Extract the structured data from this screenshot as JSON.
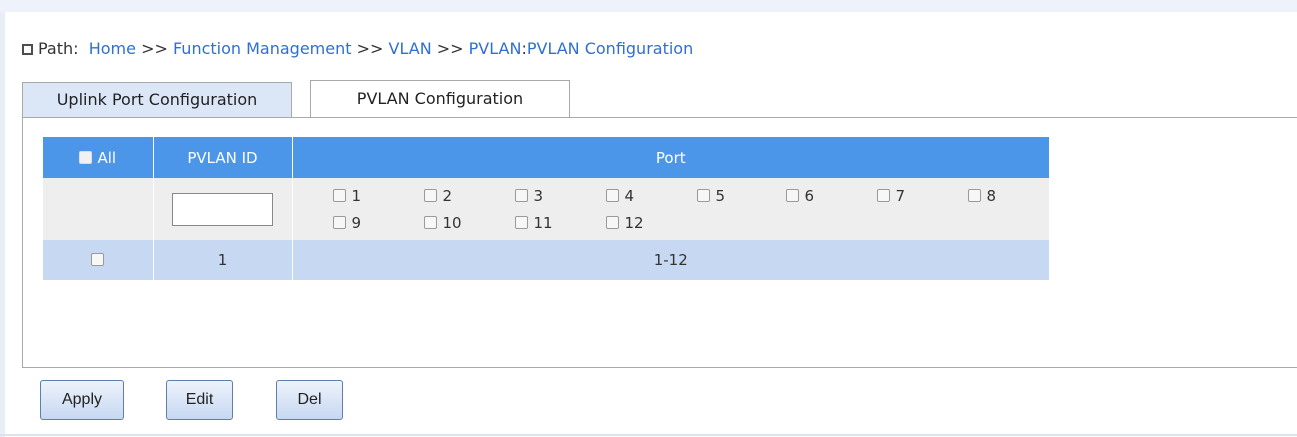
{
  "breadcrumb": {
    "label": "Path:",
    "home": "Home",
    "sep": ">>",
    "function_management": "Function Management",
    "vlan": "VLAN",
    "pvlan": "PVLAN",
    "colon": ":",
    "current": "PVLAN Configuration"
  },
  "tabs": [
    {
      "label": "Uplink Port Configuration",
      "active": false
    },
    {
      "label": "PVLAN Configuration",
      "active": true
    }
  ],
  "table": {
    "headers": {
      "all": "All",
      "pvlan_id": "PVLAN ID",
      "port": "Port"
    },
    "input": {
      "pvlan_id_value": ""
    },
    "ports": [
      "1",
      "2",
      "3",
      "4",
      "5",
      "6",
      "7",
      "8",
      "9",
      "10",
      "11",
      "12"
    ],
    "rows": [
      {
        "checked": false,
        "pvlan_id": "1",
        "port": "1-12"
      }
    ]
  },
  "buttons": {
    "apply": "Apply",
    "edit": "Edit",
    "del": "Del"
  },
  "colors": {
    "header_blue": "#4c96ea",
    "row_blue": "#c7d9f2",
    "link_blue": "#2f6fd1"
  }
}
